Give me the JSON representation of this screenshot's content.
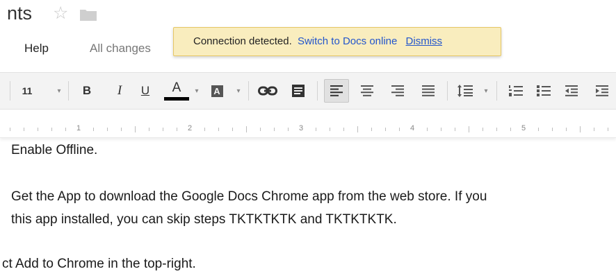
{
  "document": {
    "title": "nts",
    "menu": {
      "help": "Help",
      "save_status": "All changes"
    }
  },
  "notification": {
    "message": "Connection detected.",
    "link": "Switch to Docs online",
    "dismiss": "Dismiss",
    "colors": {
      "background": "#f9edbe",
      "border": "#e6c765",
      "link": "#2255cc"
    }
  },
  "toolbar": {
    "font_size": "11",
    "bold": "B",
    "italic": "I",
    "underline": "U",
    "text_color": "A",
    "text_color_value": "#000000",
    "highlight": "A"
  },
  "ruler": {
    "marks": [
      "1",
      "2",
      "3",
      "4",
      "5"
    ]
  },
  "body": {
    "lines": [
      "Enable Offline.",
      "Get the App to download the Google Docs Chrome app from the web store. If you",
      "this app installed, you can skip steps TKTKTKTK and TKTKTKTK.",
      "ct Add to Chrome in the top-right."
    ]
  }
}
